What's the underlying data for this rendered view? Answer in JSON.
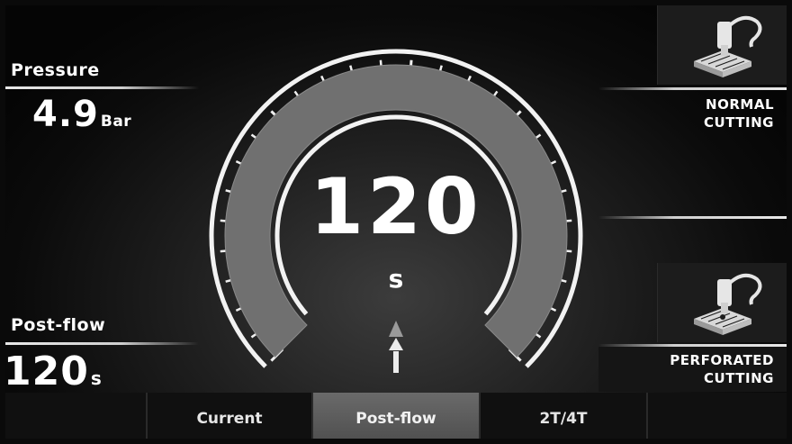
{
  "pressure": {
    "label": "Pressure",
    "value": "4.9",
    "unit": "Bar"
  },
  "postflow": {
    "label": "Post-flow",
    "value": "120",
    "unit": "s"
  },
  "gauge": {
    "value": "120",
    "unit": "s",
    "level": 1.0
  },
  "modes": [
    {
      "label_line1": "NORMAL",
      "label_line2": "CUTTING",
      "icon": "torch-plate-icon"
    },
    {
      "label_line1": "PERFORATED",
      "label_line2": "CUTTING",
      "icon": "torch-plate-icon"
    }
  ],
  "tabs": [
    {
      "label": "",
      "active": false
    },
    {
      "label": "Current",
      "active": false
    },
    {
      "label": "Post-flow",
      "active": true
    },
    {
      "label": "2T/4T",
      "active": false
    },
    {
      "label": "",
      "active": false
    }
  ],
  "colors": {
    "accent": "#ffffff",
    "active_tab": "#5c5c5c",
    "background": "#0b0b0b"
  }
}
